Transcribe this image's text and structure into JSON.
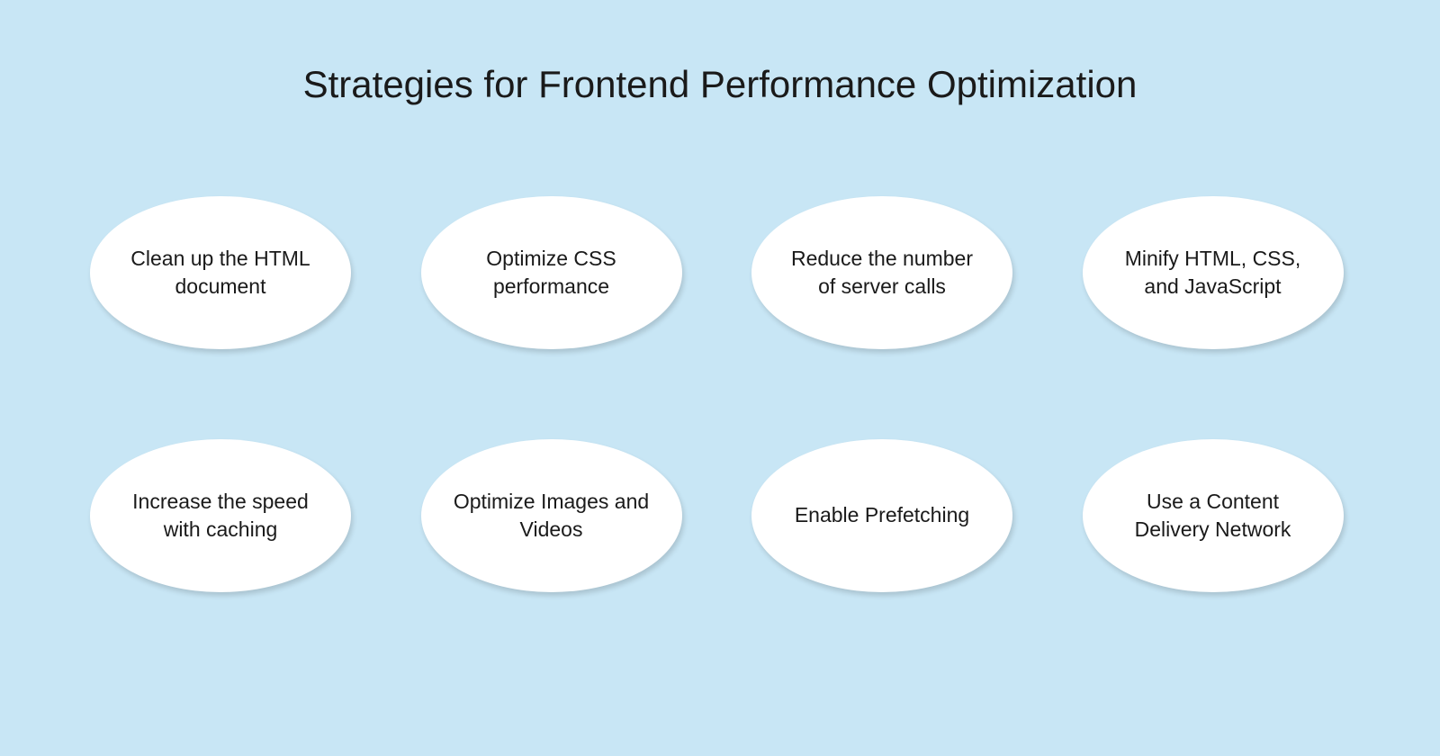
{
  "title": "Strategies for Frontend Performance Optimization",
  "items": [
    "Clean up the HTML document",
    "Optimize CSS performance",
    "Reduce the number of server calls",
    "Minify HTML, CSS, and JavaScript",
    "Increase the speed with caching",
    "Optimize Images and Videos",
    "Enable Prefetching",
    "Use a Content Delivery Network"
  ]
}
